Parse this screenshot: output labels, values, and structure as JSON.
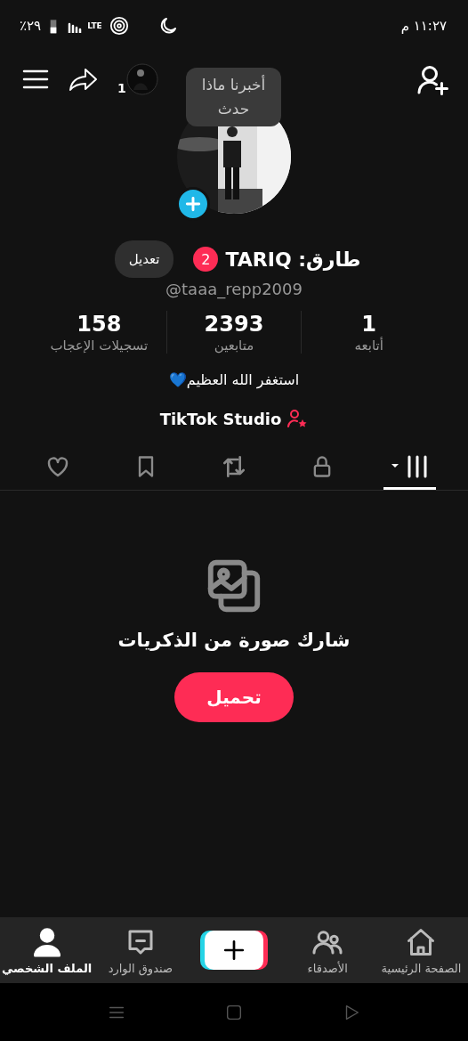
{
  "status_bar": {
    "battery": "٪٢٩",
    "network": "LTE",
    "time": "١١:٢٧ م"
  },
  "top_bar": {
    "notification_count": "1"
  },
  "tooltip": {
    "text": "أخبرنا ماذا حدث"
  },
  "profile": {
    "name": "طارق: TARIQ",
    "badge": "2",
    "edit_button": "تعديل",
    "username": "@taaa_repp2009",
    "stats": [
      {
        "value": "1",
        "label": "أتابعه"
      },
      {
        "value": "2393",
        "label": "متابعين"
      },
      {
        "value": "158",
        "label": "تسجيلات الإعجاب"
      }
    ],
    "bio": "استغفر الله العظيم💙",
    "studio_link": "TikTok Studio"
  },
  "tabs": [
    {
      "kind": "grid",
      "selected": true
    },
    {
      "kind": "lock",
      "selected": false
    },
    {
      "kind": "repost",
      "selected": false
    },
    {
      "kind": "bookmark",
      "selected": false
    },
    {
      "kind": "heart",
      "selected": false
    }
  ],
  "empty_state": {
    "message": "شارك صورة من الذكريات",
    "button": "تحميل"
  },
  "bottom_nav": [
    {
      "kind": "home",
      "label": "الصفحة الرئيسية",
      "selected": false
    },
    {
      "kind": "friends",
      "label": "الأصدقاء",
      "selected": false
    },
    {
      "kind": "create",
      "selected": false
    },
    {
      "kind": "inbox",
      "label": "صندوق الوارد",
      "selected": false
    },
    {
      "kind": "profile",
      "label": "الملف الشخصي",
      "selected": true
    }
  ]
}
